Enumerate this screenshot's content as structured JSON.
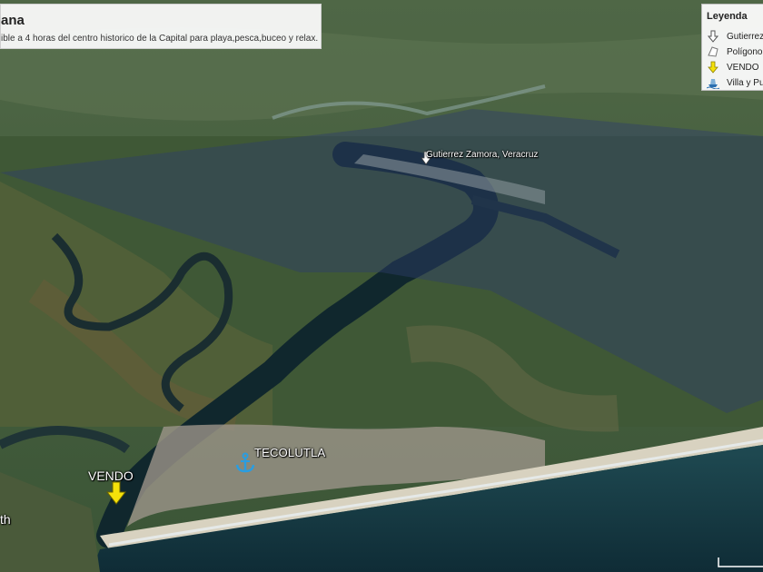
{
  "header": {
    "title": "ana",
    "description": "ible a 4 horas del centro historico de la Capital para playa,pesca,buceo y relax."
  },
  "legend": {
    "title": "Leyenda",
    "items": [
      {
        "label": "Gutierrez",
        "icon": "white-arrow-icon"
      },
      {
        "label": "Polígono",
        "icon": "polygon-icon"
      },
      {
        "label": "VENDO",
        "icon": "yellow-arrow-icon"
      },
      {
        "label": "Villa y Pu",
        "icon": "ship-icon"
      }
    ]
  },
  "places": {
    "gutierrez": "Gutierrez Zamora, Veracruz",
    "tecolutla": "TECOLUTLA",
    "vendo": "VENDO",
    "edge": "th"
  },
  "colors": {
    "vendo_arrow": "#f5e10a",
    "anchor": "#2a9de0",
    "overlay": "#2f3d6a"
  }
}
